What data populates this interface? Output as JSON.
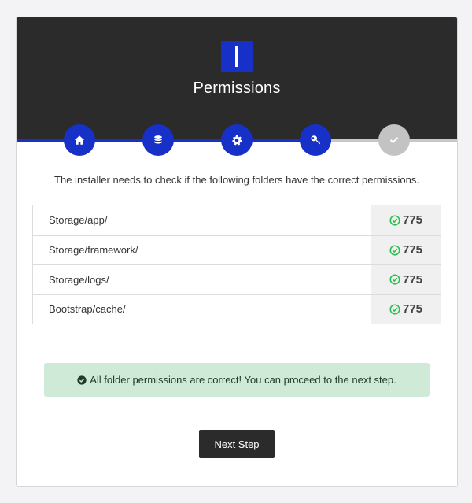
{
  "header": {
    "title": "Permissions",
    "logo_icon": "installer-logo-icon"
  },
  "steps": [
    {
      "icon": "home-icon",
      "state": "active"
    },
    {
      "icon": "database-icon",
      "state": "active"
    },
    {
      "icon": "gear-icon",
      "state": "active"
    },
    {
      "icon": "key-icon",
      "state": "active"
    },
    {
      "icon": "check-icon",
      "state": "todo"
    }
  ],
  "intro_text": "The installer needs to check if the following folders have the correct permissions.",
  "permissions": [
    {
      "folder": "Storage/app/",
      "value": "775",
      "status": "ok"
    },
    {
      "folder": "Storage/framework/",
      "value": "775",
      "status": "ok"
    },
    {
      "folder": "Storage/logs/",
      "value": "775",
      "status": "ok"
    },
    {
      "folder": "Bootstrap/cache/",
      "value": "775",
      "status": "ok"
    }
  ],
  "alert": {
    "text": "All folder permissions are correct! You can proceed to the next step.",
    "icon": "check-circle-icon"
  },
  "next_button_label": "Next Step",
  "colors": {
    "primary": "#1630c8",
    "header_bg": "#2b2b2b",
    "success": "#2dbe50",
    "alert_bg": "#cfead7",
    "inactive_step": "#c3c3c3"
  }
}
